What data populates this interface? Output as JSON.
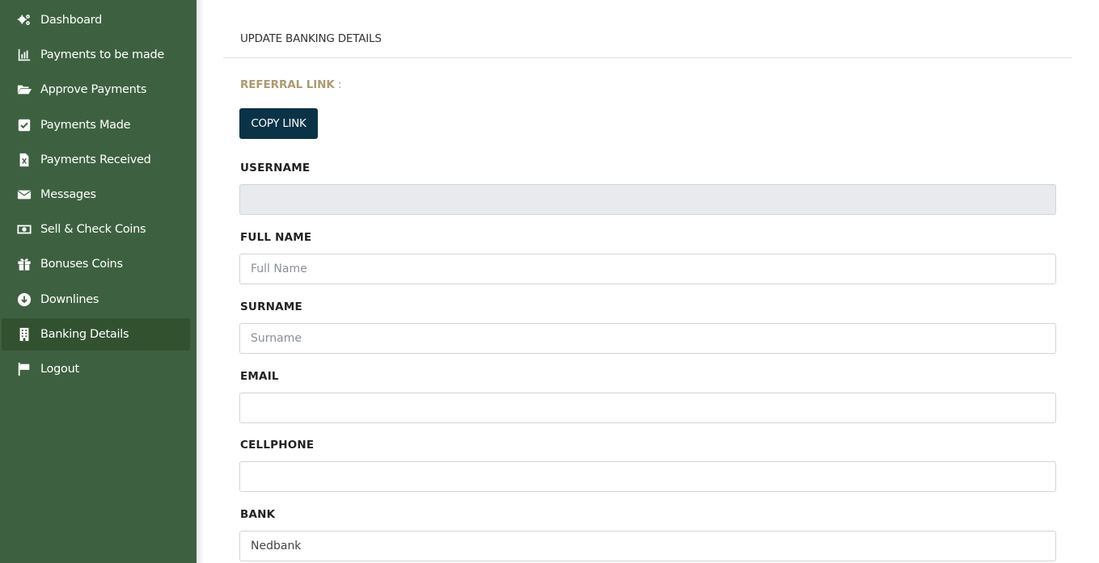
{
  "sidebar": {
    "items": [
      {
        "label": "Dashboard",
        "icon": "cogs-icon"
      },
      {
        "label": "Payments to be made",
        "icon": "bar-chart-icon"
      },
      {
        "label": "Approve Payments",
        "icon": "folder-open-icon"
      },
      {
        "label": "Payments Made",
        "icon": "check-square-icon"
      },
      {
        "label": "Payments Received",
        "icon": "file-excel-icon"
      },
      {
        "label": "Messages",
        "icon": "envelope-icon"
      },
      {
        "label": "Sell & Check Coins",
        "icon": "money-bill-icon"
      },
      {
        "label": "Bonuses Coins",
        "icon": "gift-icon"
      },
      {
        "label": "Downlines",
        "icon": "arrow-circle-down-icon"
      },
      {
        "label": "Banking Details",
        "icon": "building-icon",
        "active": true
      },
      {
        "label": "Logout",
        "icon": "flag-icon"
      }
    ]
  },
  "main": {
    "title": "UPDATE BANKING DETAILS",
    "referral_label": "REFERRAL LINK",
    "referral_colon": " :",
    "copy_button": "COPY LINK",
    "fields": {
      "username": {
        "label": "USERNAME",
        "value": "",
        "placeholder": ""
      },
      "full_name": {
        "label": "FULL NAME",
        "value": "",
        "placeholder": "Full Name"
      },
      "surname": {
        "label": "SURNAME",
        "value": "",
        "placeholder": "Surname"
      },
      "email": {
        "label": "EMAIL",
        "value": "",
        "placeholder": ""
      },
      "cellphone": {
        "label": "CELLPHONE",
        "value": "",
        "placeholder": ""
      },
      "bank": {
        "label": "BANK",
        "value": "Nedbank",
        "placeholder": ""
      }
    }
  },
  "colors": {
    "sidebar_bg": "#3d6140",
    "sidebar_active": "#32512f",
    "button_bg": "#0b3347",
    "referral_label": "#ad9a70"
  }
}
